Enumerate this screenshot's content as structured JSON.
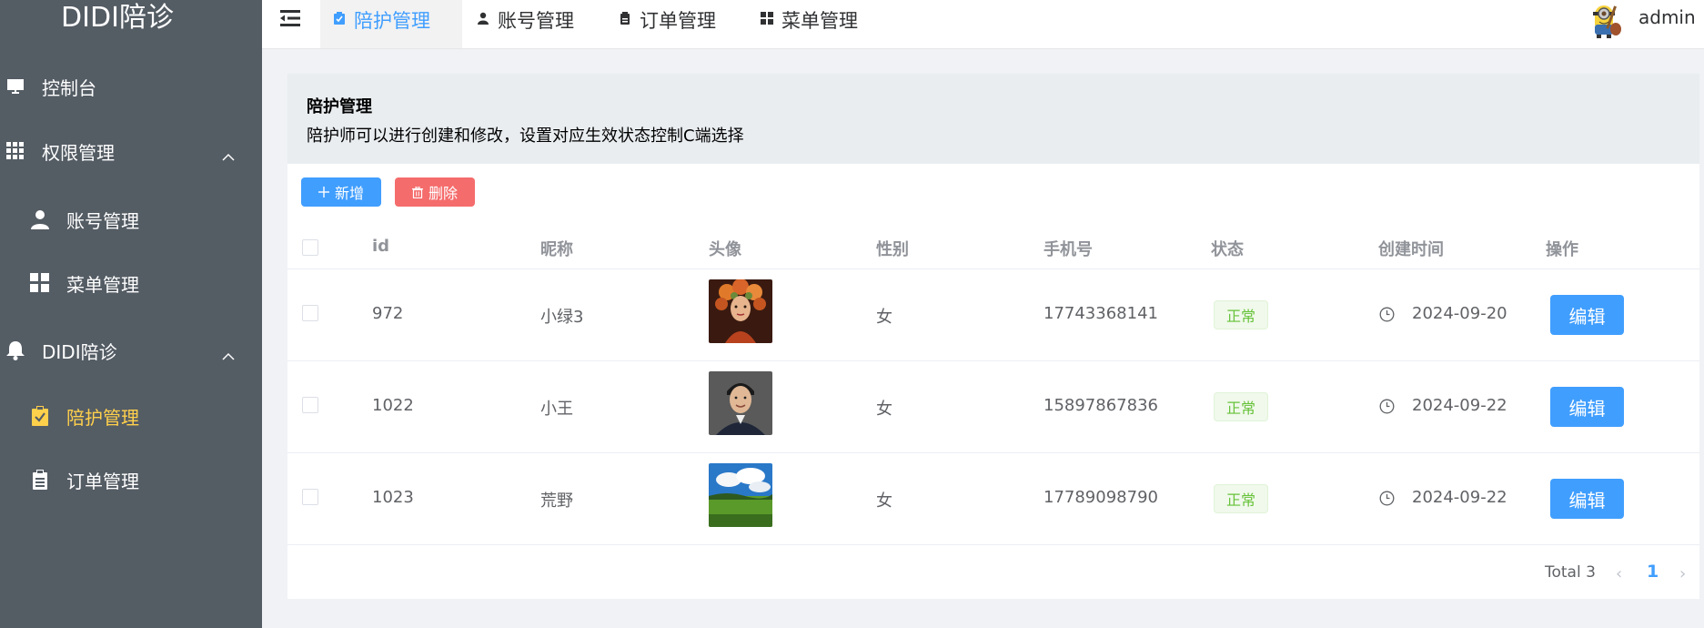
{
  "brand": "DIDI陪诊",
  "sidebar": {
    "items": [
      {
        "label": "控制台",
        "icon": "monitor-icon"
      },
      {
        "label": "权限管理",
        "icon": "grid-icon"
      },
      {
        "label": "账号管理",
        "icon": "user-icon"
      },
      {
        "label": "菜单管理",
        "icon": "menu-icon"
      },
      {
        "label": "DIDI陪诊",
        "icon": "bell-icon"
      },
      {
        "label": "陪护管理",
        "icon": "clipboard-check-icon"
      },
      {
        "label": "订单管理",
        "icon": "clipboard-icon"
      }
    ],
    "active_color": "#ffd04b"
  },
  "header": {
    "tabs": [
      {
        "label": "陪护管理"
      },
      {
        "label": "账号管理"
      },
      {
        "label": "订单管理"
      },
      {
        "label": "菜单管理"
      }
    ],
    "username": "admin"
  },
  "panel": {
    "title": "陪护管理",
    "description": "陪护师可以进行创建和修改，设置对应生效状态控制C端选择"
  },
  "toolbar": {
    "add_label": "新增",
    "delete_label": "删除"
  },
  "table": {
    "columns": [
      "id",
      "昵称",
      "头像",
      "性别",
      "手机号",
      "状态",
      "创建时间",
      "操作"
    ],
    "rows": [
      {
        "id": "972",
        "nickname": "小绿3",
        "gender": "女",
        "phone": "17743368141",
        "status": "正常",
        "created": "2024-09-20",
        "action": "编辑",
        "avatar": "woman-portrait"
      },
      {
        "id": "1022",
        "nickname": "小王",
        "gender": "女",
        "phone": "15897867836",
        "status": "正常",
        "created": "2024-09-22",
        "action": "编辑",
        "avatar": "man-portrait"
      },
      {
        "id": "1023",
        "nickname": "荒野",
        "gender": "女",
        "phone": "17789098790",
        "status": "正常",
        "created": "2024-09-22",
        "action": "编辑",
        "avatar": "landscape"
      }
    ]
  },
  "pagination": {
    "total": "Total 3",
    "current": "1"
  },
  "colors": {
    "primary": "#409eff",
    "danger": "#f56c6c",
    "success": "#67c23a",
    "sidebar_bg": "#545c64"
  }
}
